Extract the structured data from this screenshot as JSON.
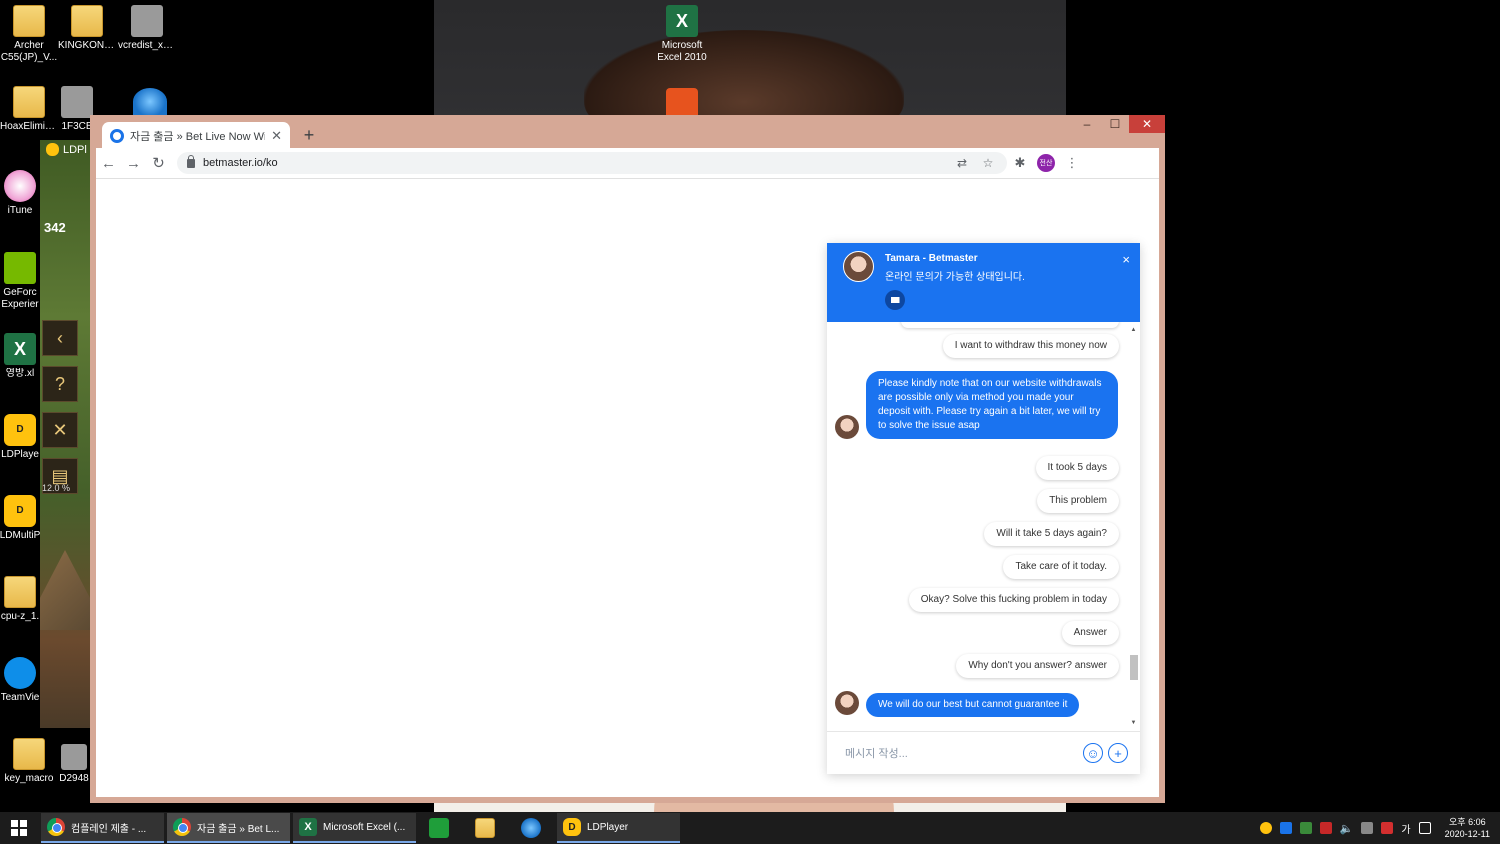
{
  "desktop": {
    "icons": [
      {
        "label": "Archer C55(JP)_V...",
        "kind": "folder"
      },
      {
        "label": "KINGKONG...",
        "kind": "folder"
      },
      {
        "label": "vcredist_x6...",
        "kind": "gen"
      },
      {
        "label": "Microsoft Excel 2010",
        "kind": "excel"
      },
      {
        "label": "HoaxElimin...",
        "kind": "folder"
      },
      {
        "label": "1F3CB",
        "kind": "gen"
      },
      {
        "label": "iTune",
        "kind": "itunes"
      },
      {
        "label": "GeForc Experier",
        "kind": "nv"
      },
      {
        "label": "영방.xl",
        "kind": "excel"
      },
      {
        "label": "LDPlaye",
        "kind": "ld"
      },
      {
        "label": "LDMultiP",
        "kind": "ld"
      },
      {
        "label": "cpu-z_1.",
        "kind": "folder"
      },
      {
        "label": "TeamVie",
        "kind": "tv"
      },
      {
        "label": "key_macro",
        "kind": "folder"
      },
      {
        "label": "D2948",
        "kind": "gen"
      }
    ],
    "ldp_tag": "LDPl",
    "game": {
      "counter": "342",
      "percent": "12.0 %"
    }
  },
  "browser": {
    "tab_title": "자금 출금 » Bet Live Now With",
    "url": "betmaster.io/ko",
    "profile_label": "전산",
    "window_buttons": {
      "minimize": "–",
      "maximize": "☐",
      "close": "✕"
    }
  },
  "chat": {
    "agent_name": "Tamara - Betmaster",
    "agent_status": "온라인 문의가 가능한 상태입니다.",
    "close_label": "×",
    "input_placeholder": "메시지 작성...",
    "messages": [
      {
        "from": "user",
        "text": "I want to withdraw this money now"
      },
      {
        "from": "agent",
        "text": "Please kindly note that on our website withdrawals are possible only via method you made your deposit with. Please try again a bit later, we will try to solve the issue asap"
      },
      {
        "from": "user",
        "text": "It took 5 days"
      },
      {
        "from": "user",
        "text": "This problem"
      },
      {
        "from": "user",
        "text": "Will it take 5 days again?"
      },
      {
        "from": "user",
        "text": "Take care of it today."
      },
      {
        "from": "user",
        "text": "Okay? Solve this fucking problem in today"
      },
      {
        "from": "user",
        "text": "Answer"
      },
      {
        "from": "user",
        "text": "Why don't you answer? answer"
      },
      {
        "from": "agent",
        "text": "We will do our best but cannot guarantee it"
      }
    ]
  },
  "taskbar": {
    "buttons": [
      {
        "label": "컴플레인 제출 - ...",
        "icon": "chrome-icon"
      },
      {
        "label": "자금 출금 » Bet L...",
        "icon": "chrome-icon",
        "active": true
      },
      {
        "label": "Microsoft Excel (...",
        "icon": "excel-icon"
      },
      {
        "label": "LDPlayer",
        "icon": "ldplayer-icon"
      }
    ],
    "tray": {
      "ime": "가",
      "time": "오후 6:06",
      "date": "2020-12-11"
    }
  }
}
